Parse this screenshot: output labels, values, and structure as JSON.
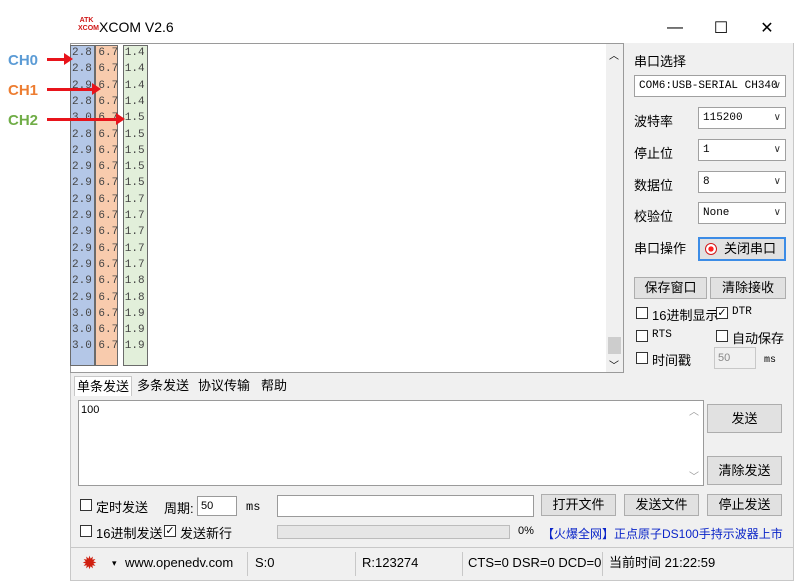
{
  "annotations": {
    "ch0": {
      "label": "CH0",
      "color": "#5b9bd5"
    },
    "ch1": {
      "label": "CH1",
      "color": "#ed7d31"
    },
    "ch2": {
      "label": "CH2",
      "color": "#70ad47"
    },
    "arrow_color": "#e8141b"
  },
  "window": {
    "title": "XCOM V2.6",
    "logo_text": "ATK XCOM",
    "minimize": "—",
    "maximize": "☐",
    "close": "✕"
  },
  "receive": {
    "rows": [
      [
        "2.8",
        "6.7",
        "1.4"
      ],
      [
        "2.8",
        "6.7",
        "1.4"
      ],
      [
        "2.9",
        "6.7",
        "1.4"
      ],
      [
        "2.8",
        "6.7",
        "1.4"
      ],
      [
        "3.0",
        "6.7",
        "1.5"
      ],
      [
        "2.8",
        "6.7",
        "1.5"
      ],
      [
        "2.9",
        "6.7",
        "1.5"
      ],
      [
        "2.9",
        "6.7",
        "1.5"
      ],
      [
        "2.9",
        "6.7",
        "1.5"
      ],
      [
        "2.9",
        "6.7",
        "1.7"
      ],
      [
        "2.9",
        "6.7",
        "1.7"
      ],
      [
        "2.9",
        "6.7",
        "1.7"
      ],
      [
        "2.9",
        "6.7",
        "1.7"
      ],
      [
        "2.9",
        "6.7",
        "1.7"
      ],
      [
        "2.9",
        "6.7",
        "1.8"
      ],
      [
        "2.9",
        "6.7",
        "1.8"
      ],
      [
        "3.0",
        "6.7",
        "1.9"
      ],
      [
        "3.0",
        "6.7",
        "1.9"
      ],
      [
        "3.0",
        "6.7",
        "1.9"
      ]
    ],
    "col_colors": [
      "#b4c7e7",
      "#f8cbad",
      "#e2efda"
    ]
  },
  "panel": {
    "port_select_label": "串口选择",
    "port_value": "COM6:USB-SERIAL CH340",
    "baud_label": "波特率",
    "baud_value": "115200",
    "stopbits_label": "停止位",
    "stopbits_value": "1",
    "databits_label": "数据位",
    "databits_value": "8",
    "parity_label": "校验位",
    "parity_value": "None",
    "port_op_label": "串口操作",
    "close_port_button": "关闭串口",
    "save_window_button": "保存窗口",
    "clear_recv_button": "清除接收",
    "hex_display_label": "16进制显示",
    "dtr_label": "DTR",
    "rts_label": "RTS",
    "auto_save_label": "自动保存",
    "timestamp_label": "时间戳",
    "timestamp_value": "50",
    "timestamp_unit": "ms"
  },
  "tabs": [
    "单条发送",
    "多条发送",
    "协议传输",
    "帮助"
  ],
  "send": {
    "text": "100",
    "send_button": "发送",
    "clear_send_button": "清除发送",
    "timed_send_label": "定时发送",
    "period_label": "周期:",
    "period_value": "50",
    "period_unit": "ms",
    "open_file_button": "打开文件",
    "send_file_button": "发送文件",
    "stop_send_button": "停止发送",
    "hex_send_label": "16进制发送",
    "send_newline_label": "发送新行",
    "progress_percent": "0%",
    "ad_text": "【火爆全网】正点原子DS100手持示波器上市"
  },
  "status": {
    "url": "www.openedv.com",
    "sent": "S:0",
    "received": "R:123274",
    "lines": "CTS=0 DSR=0 DCD=0",
    "time": "当前时间 21:22:59"
  }
}
